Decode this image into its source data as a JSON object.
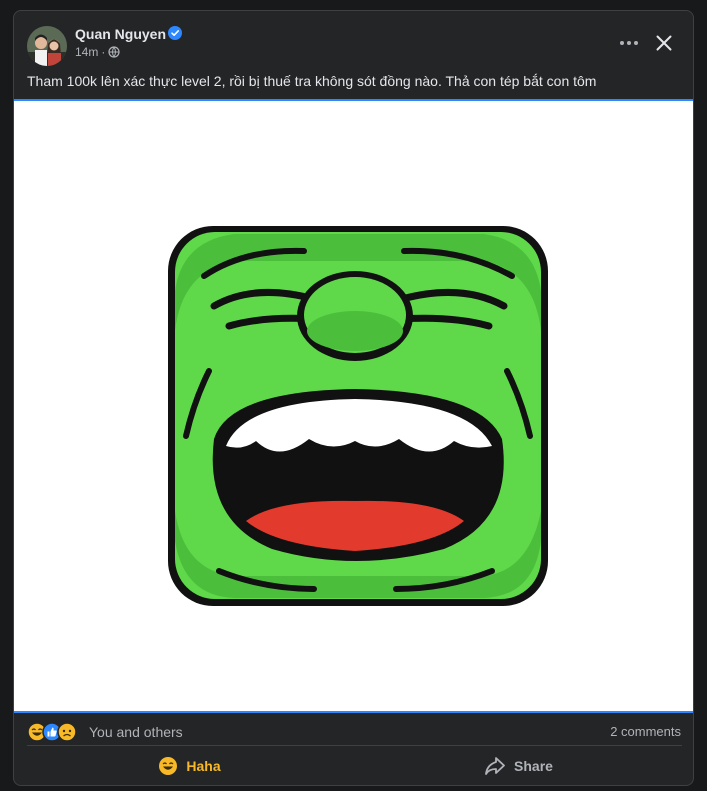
{
  "post": {
    "author": "Quan Nguyen",
    "time": "14m",
    "separator": "·",
    "caption": "Tham 100k lên xác thực level 2, rồi bị thuế tra không sót đồng nào. Thả con tép bắt con tôm"
  },
  "reactions": {
    "summary": "You and others",
    "comments": "2 comments",
    "icons": [
      "haha-icon",
      "like-icon",
      "sad-icon"
    ]
  },
  "actions": {
    "haha_label": "Haha",
    "share_label": "Share"
  },
  "colors": {
    "accent": "#2d88ff",
    "haha": "#f7b928",
    "card_bg": "#242526",
    "emoji_green": "#5fd94a"
  }
}
